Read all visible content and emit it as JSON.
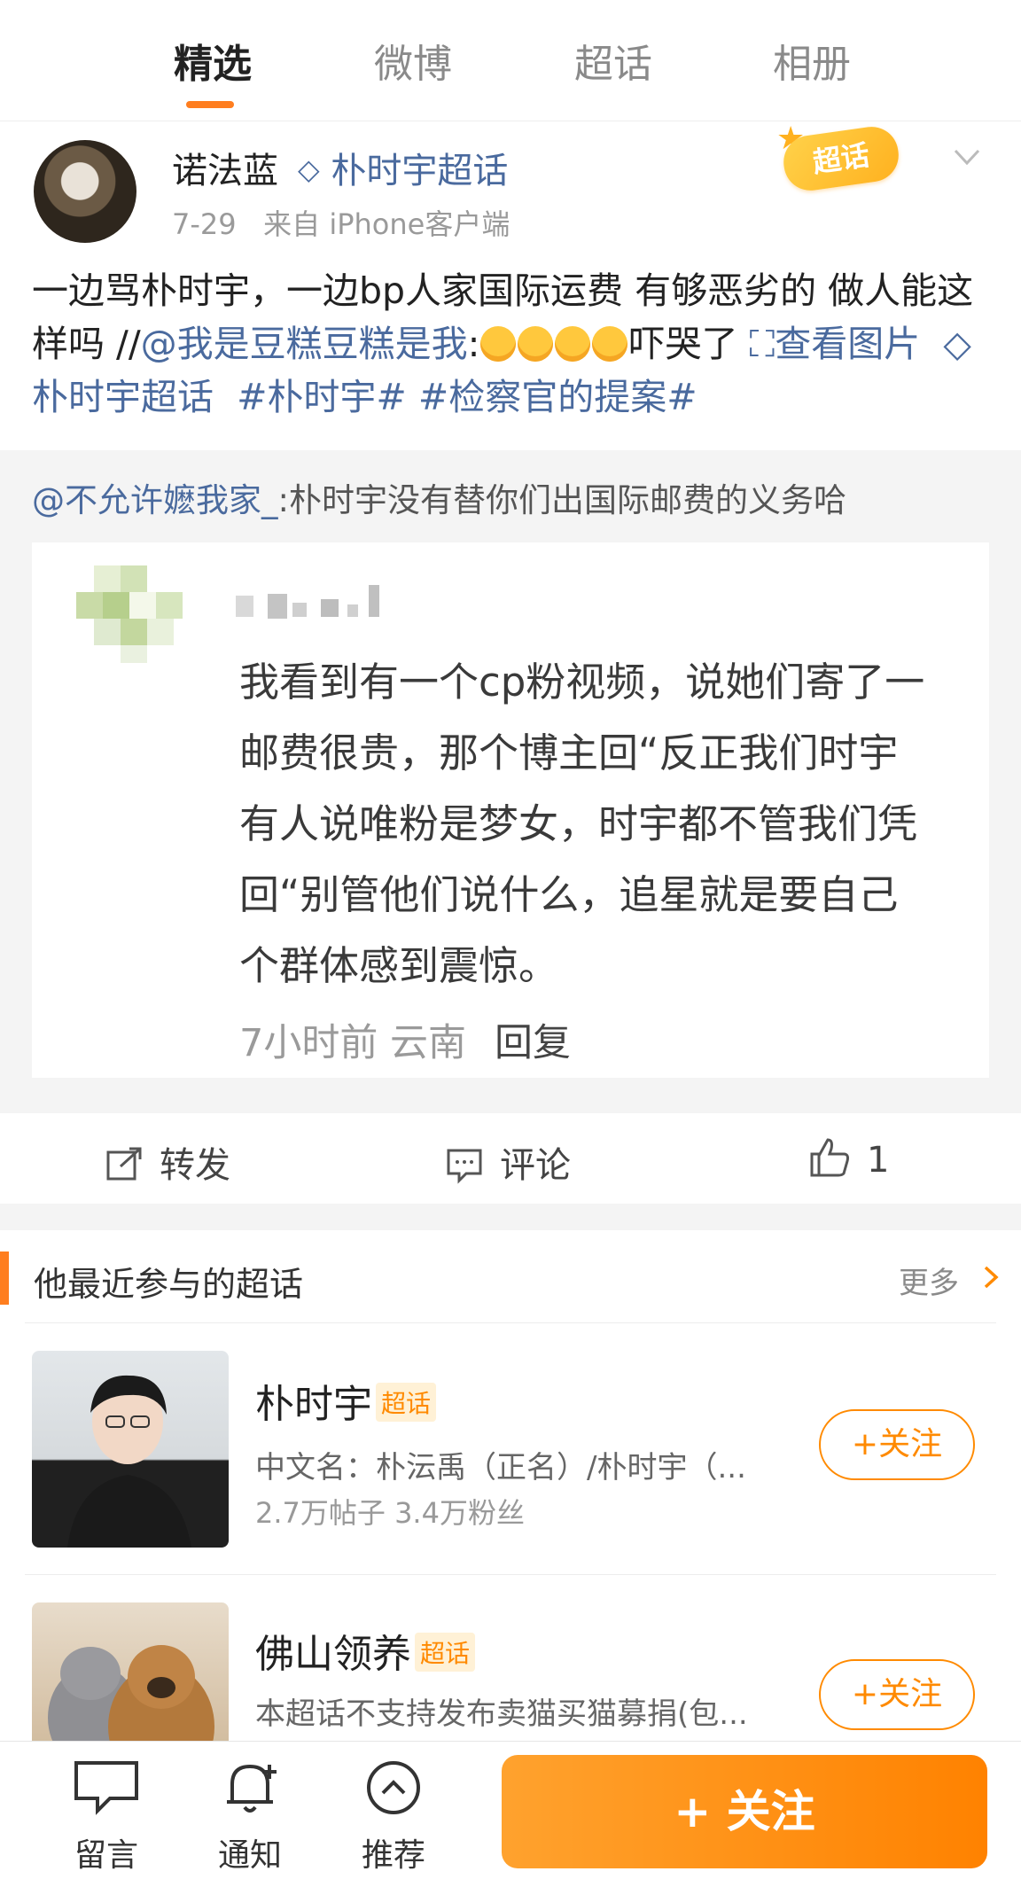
{
  "tabs": [
    "精选",
    "微博",
    "超话",
    "相册"
  ],
  "post": {
    "username": "诺法蓝",
    "topic": "朴时宇超话",
    "date": "7-29",
    "source": "来自 iPhone客户端",
    "badge": "超话",
    "text_main": "一边骂朴时宇，一边bp人家国际运费 有够恶劣的 做人能这样吗 //",
    "mention": "@我是豆糕豆糕是我",
    "text_after_emoji": "吓哭了",
    "view_image": "查看图片",
    "topic_link": "朴时宇超话",
    "hashtag1": "#朴时宇#",
    "hashtag2": "#检察官的提案#"
  },
  "quote": {
    "mention": "@不允许嬷我家_",
    "text": ":朴时宇没有替你们出国际邮费的义务哈",
    "lines": [
      "我看到有一个cp粉视频，说她们寄了一",
      "邮费很贵，那个博主回“反正我们时宇",
      "有人说唯粉是梦女，时宇都不管我们凭",
      "回“别管他们说什么，追星就是要自己",
      "个群体感到震惊。"
    ],
    "meta_time": "7小时前 云南",
    "meta_reply": "回复"
  },
  "actions": {
    "repost": "转发",
    "comment": "评论",
    "like_count": "1"
  },
  "section": {
    "title": "他最近参与的超话",
    "more": "更多"
  },
  "topics": [
    {
      "name": "朴时宇",
      "tag": "超话",
      "desc": "中文名：朴沄禹（正名）/朴时宇（...",
      "stats": "2.7万帖子 3.4万粉丝",
      "follow": "+关注"
    },
    {
      "name": "佛山领养",
      "tag": "超话",
      "desc": "本超话不支持发布卖猫买猫募捐(包...",
      "stats": "",
      "follow": "+关注"
    }
  ],
  "bottom": {
    "message": "留言",
    "notify": "通知",
    "recommend": "推荐",
    "follow": "+ 关注"
  },
  "colors": {
    "accent": "#ff8a00",
    "link": "#4a6a9e"
  }
}
